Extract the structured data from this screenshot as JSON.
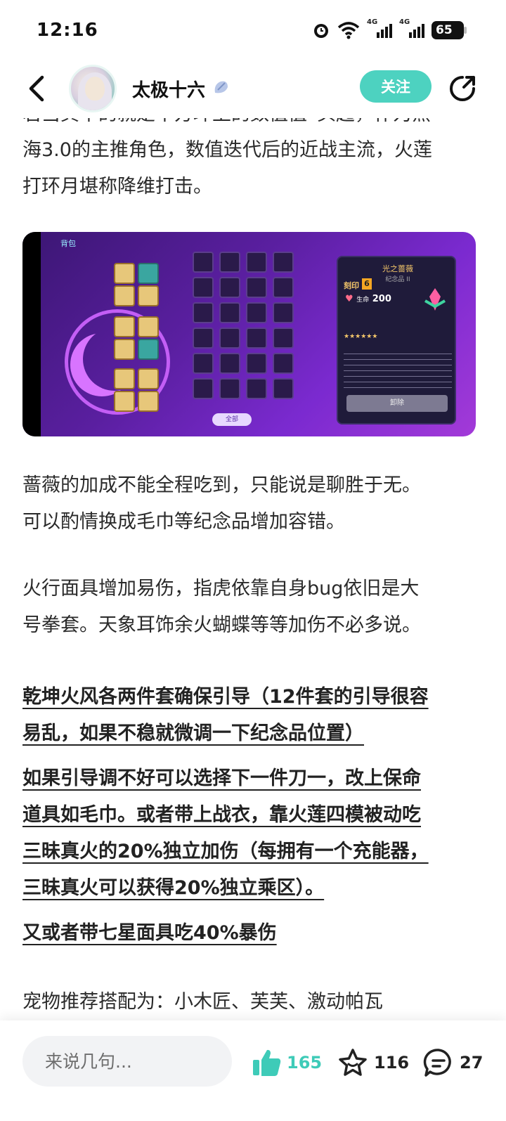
{
  "status_bar": {
    "time": "12:16",
    "network_1": "4G",
    "network_2": "4G",
    "battery": "65"
  },
  "header": {
    "username": "太极十六",
    "follow_label": "关注"
  },
  "article": {
    "para1_line0": "若当其中的就是中方环上的数值值“头起，作为黑",
    "para1_line1": "海3.0的主推角色，数值迭代后的近战主流，火莲",
    "para1_line2": "打环月堪称降维打击。",
    "para2_line1": "蔷薇的加成不能全程吃到，只能说是聊胜于无。",
    "para2_line2": "可以酌情换成毛巾等纪念品增加容错。",
    "para3_line1": "火行面具增加易伤，指虎依靠自身bug依旧是大",
    "para3_line2": "号拳套。天象耳饰余火蝴蝶等等加伤不必多说。",
    "bold1_line1": "乾坤火风各两件套确保引导（12件套的引导很容",
    "bold1_line2": "易乱，如果不稳就微调一下纪念品位置）",
    "bold2_line1": "如果引导调不好可以选择下一件刀一，改上保命",
    "bold2_line2": "道具如毛巾。或者带上战衣，靠火莲四模被动吃",
    "bold2_line3": "三昧真火的20%独立加伤（每拥有一个充能器，",
    "bold2_line4": "三昧真火可以获得20%独立乘区）。",
    "bold3_line1": "又或者带七星面具吃40%暴伤",
    "para4_line1": "宠物推荐搭配为：小木匠、芙芙、激动帕瓦"
  },
  "game_image": {
    "back_label": "背包",
    "panel_title": "光之蔷薇",
    "panel_subtitle": "纪念品 II",
    "panel_level_label": "刻印",
    "panel_level": "6",
    "panel_stat_label": "生命",
    "panel_stat_value": "200",
    "panel_button": "卸除",
    "all_button": "全部"
  },
  "bottom_bar": {
    "comment_placeholder": "来说几句...",
    "like_count": "165",
    "fav_count": "116",
    "comment_count": "27"
  },
  "colors": {
    "accent": "#4dd2c0",
    "like": "#3ecbb8"
  }
}
